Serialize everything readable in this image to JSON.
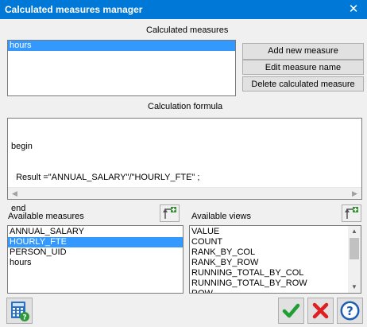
{
  "window": {
    "title": "Calculated measures manager",
    "close_glyph": "✕"
  },
  "calculated": {
    "heading": "Calculated measures",
    "items": [
      {
        "label": "hours",
        "selected": true
      }
    ],
    "buttons": {
      "add": "Add new measure",
      "edit": "Edit measure name",
      "delete": "Delete calculated measure"
    }
  },
  "formula": {
    "heading": "Calculation formula",
    "lines": [
      "begin",
      "  Result =\"ANNUAL_SALARY\"/\"HOURLY_FTE\" ;",
      "end"
    ]
  },
  "available_measures": {
    "heading": "Available measures",
    "items": [
      {
        "label": "ANNUAL_SALARY",
        "selected": false
      },
      {
        "label": "HOURLY_FTE",
        "selected": true
      },
      {
        "label": "PERSON_UID",
        "selected": false
      },
      {
        "label": "hours",
        "selected": false
      }
    ]
  },
  "available_views": {
    "heading": "Available views",
    "items": [
      "VALUE",
      "COUNT",
      "RANK_BY_COL",
      "RANK_BY_ROW",
      "RUNNING_TOTAL_BY_COL",
      "RUNNING_TOTAL_BY_ROW",
      "ROW"
    ]
  },
  "icons": {
    "insert_measure": "insert-arrow-icon",
    "insert_view": "insert-arrow-icon",
    "calculator": "calculator-help-icon",
    "ok": "check-icon",
    "cancel": "x-icon",
    "help": "question-icon"
  },
  "colors": {
    "titlebar": "#0078d7",
    "selection": "#3399ff",
    "ok_green": "#1e9e33",
    "cancel_red": "#e02020",
    "help_blue": "#1e5fb4"
  }
}
